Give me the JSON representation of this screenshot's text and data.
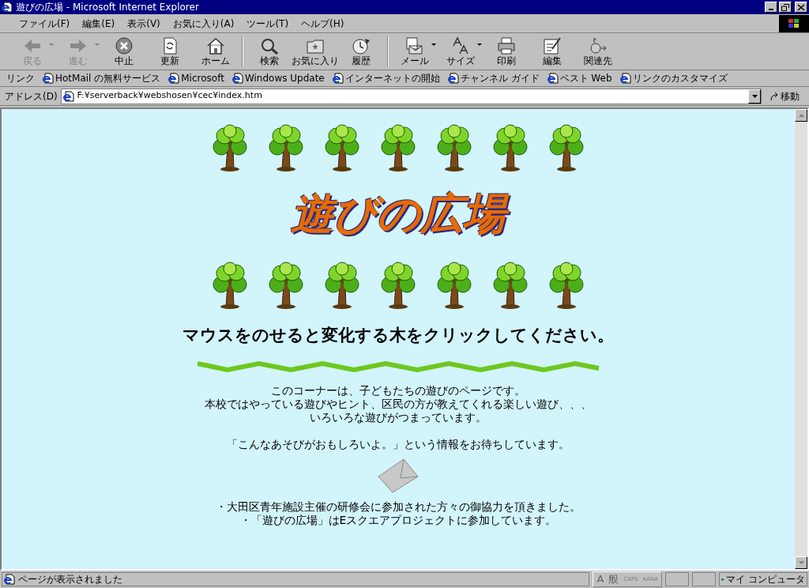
{
  "window": {
    "title": "遊びの広場 - Microsoft Internet Explorer"
  },
  "menu": [
    "ファイル(F)",
    "編集(E)",
    "表示(V)",
    "お気に入り(A)",
    "ツール(T)",
    "ヘルプ(H)"
  ],
  "toolbar": [
    {
      "kind": "back",
      "label": "戻る",
      "disabled": true,
      "dropdown": true
    },
    {
      "kind": "forward",
      "label": "進む",
      "disabled": true,
      "dropdown": true
    },
    {
      "kind": "stop",
      "label": "中止",
      "disabled": false,
      "dropdown": false
    },
    {
      "kind": "refresh",
      "label": "更新",
      "disabled": false,
      "dropdown": false
    },
    {
      "kind": "home",
      "label": "ホーム",
      "disabled": false,
      "dropdown": false
    },
    {
      "kind": "search",
      "label": "検索",
      "disabled": false,
      "dropdown": false
    },
    {
      "kind": "favorites",
      "label": "お気に入り",
      "disabled": false,
      "dropdown": false
    },
    {
      "kind": "history",
      "label": "履歴",
      "disabled": false,
      "dropdown": false
    },
    {
      "kind": "mail",
      "label": "メール",
      "disabled": false,
      "dropdown": true
    },
    {
      "kind": "size",
      "label": "サイズ",
      "disabled": false,
      "dropdown": true
    },
    {
      "kind": "print",
      "label": "印刷",
      "disabled": false,
      "dropdown": false
    },
    {
      "kind": "edit",
      "label": "編集",
      "disabled": false,
      "dropdown": false
    },
    {
      "kind": "related",
      "label": "関連先",
      "disabled": false,
      "dropdown": false
    }
  ],
  "links": {
    "label": "リンク",
    "items": [
      "HotMail の無料サービス",
      "Microsoft",
      "Windows Update",
      "インターネットの開始",
      "チャンネル ガイド",
      "ベスト Web",
      "リンクのカスタマイズ"
    ]
  },
  "address": {
    "label": "アドレス(D)",
    "value": "F:¥serverback¥webshosen¥cec¥index.htm",
    "go": "移動"
  },
  "page": {
    "logo": "遊びの広場",
    "heading": "マウスをのせると変化する木をクリックしてください。",
    "intro": [
      "このコーナーは、子どもたちの遊びのページです。",
      "本校ではやっている遊びやヒント、区民の方が教えてくれる楽しい遊び、、、",
      "いろいろな遊びがつまっています。"
    ],
    "request": "「こんなあそびがおもしろいよ。」という情報をお待ちしています。",
    "notes": [
      "・大田区青年施設主催の研修会に参加された方々の御協力を頂きました。",
      "・「遊びの広場」はEスクエアプロジェクトに参加しています。"
    ]
  },
  "status_bar": {
    "text": "ページが表示されました",
    "ime": [
      "A",
      "般",
      "CAPS",
      "KANA"
    ],
    "zone": "マイ コンピュータ"
  }
}
